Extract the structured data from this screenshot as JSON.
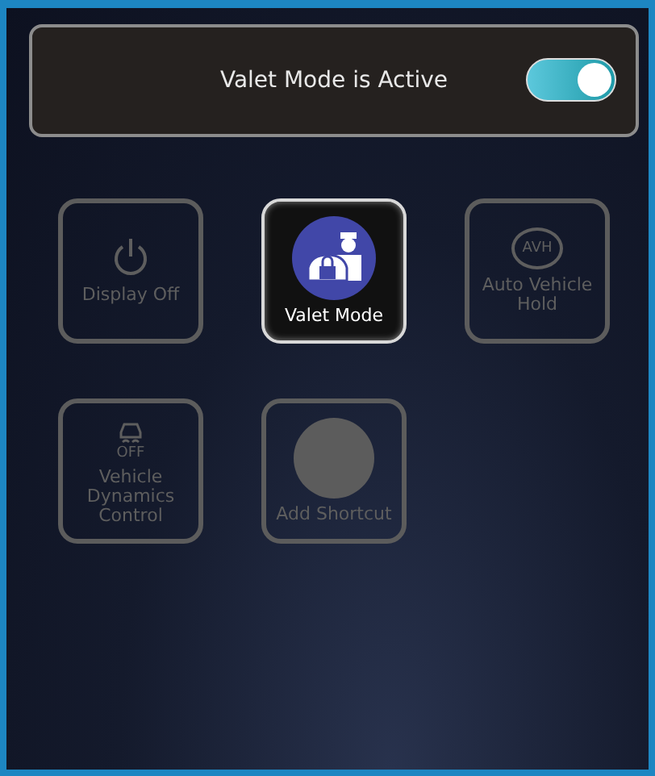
{
  "banner": {
    "label": "Valet Mode is Active",
    "toggle": {
      "on": true
    }
  },
  "tiles": [
    {
      "kind": "power",
      "label": "Display Off",
      "disabled": true
    },
    {
      "kind": "valet",
      "label": "Valet Mode",
      "disabled": false
    },
    {
      "kind": "avh",
      "label": "Auto Vehicle Hold",
      "icon_text": "AVH",
      "disabled": true
    },
    {
      "kind": "vdc",
      "label": "Vehicle Dynamics Control",
      "icon_text": "OFF",
      "disabled": true
    },
    {
      "kind": "add",
      "label": "Add Shortcut",
      "disabled": true
    }
  ]
}
